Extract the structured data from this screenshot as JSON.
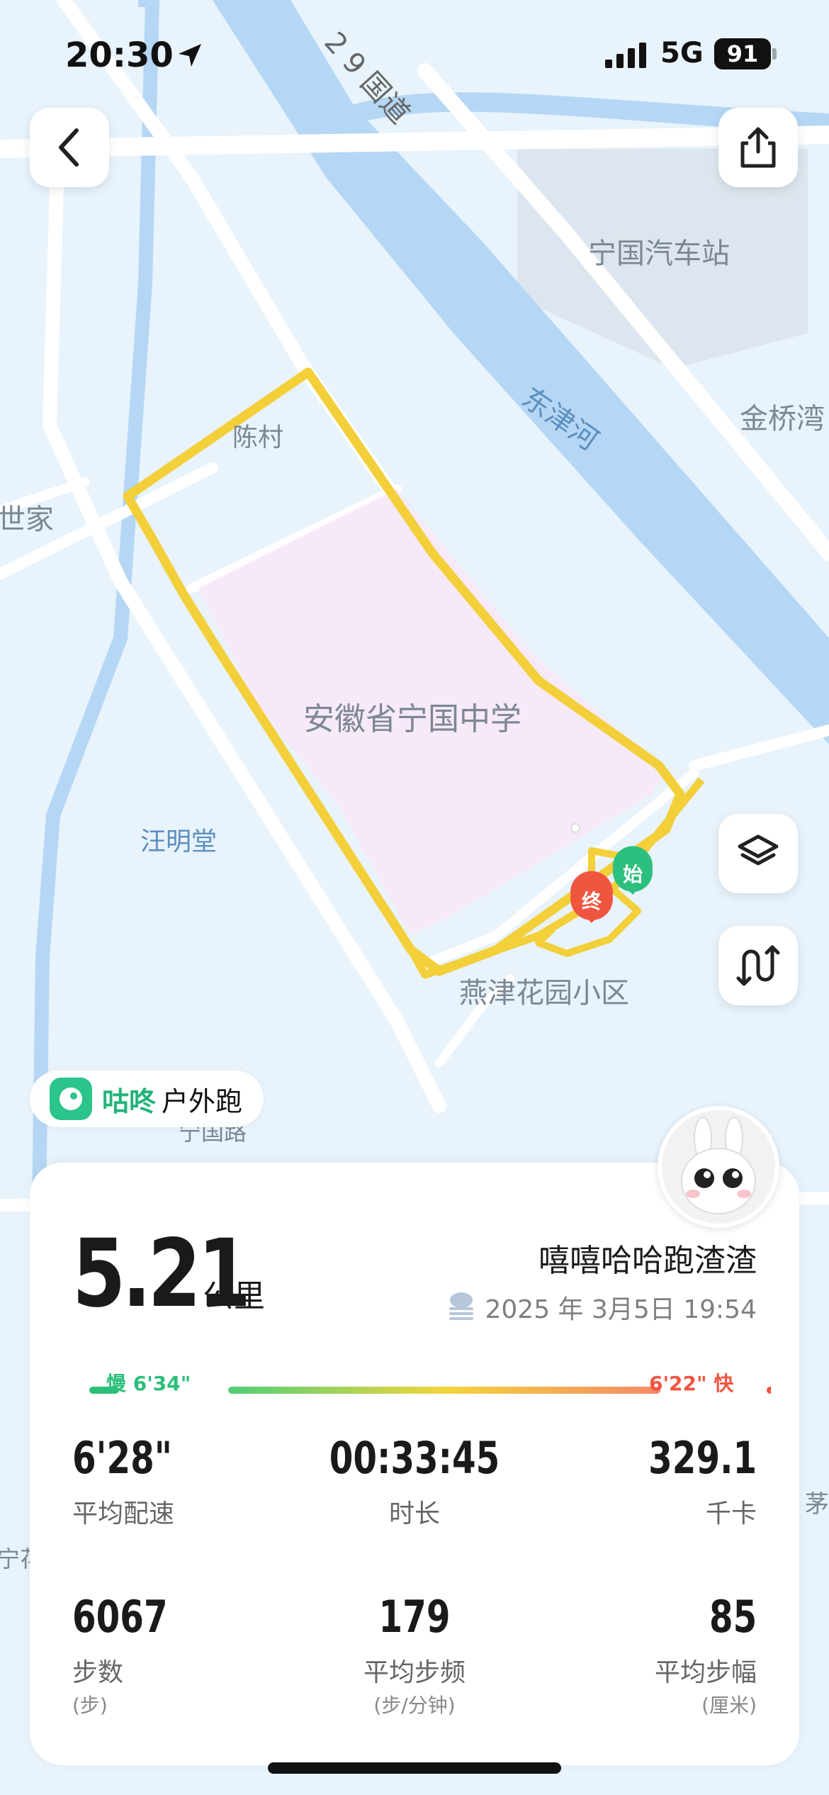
{
  "status_bar": {
    "time": "20:30",
    "network": "5G",
    "battery": "91"
  },
  "map": {
    "labels": {
      "highway": "2 9 国道",
      "bus_station": "宁国汽车站",
      "river": "东津河",
      "village": "陈村",
      "jinqiao": "金桥湾",
      "shijia": "世家",
      "school": "安徽省宁国中学",
      "wangmingtang": "汪明堂",
      "community": "燕津花园小区",
      "partial_road": "宁国路",
      "right_edge": "茅",
      "left_edge": "宁花"
    },
    "markers": {
      "start": "始",
      "end": "终"
    },
    "route_color": "#f3cf3a",
    "school_area_color": "#f6e9f8",
    "river_color": "#b5d7f5"
  },
  "source_badge": {
    "brand": "咕咚",
    "activity_type": "户外跑"
  },
  "summary": {
    "distance": "5.21",
    "distance_unit": "公里",
    "username": "嘻嘻哈哈跑渣渣",
    "datetime": "2025 年 3月5日 19:54",
    "pace_slow": "慢 6'34\"",
    "pace_fast": "6'22\" 快"
  },
  "stats": {
    "avg_pace": {
      "value": "6'28\"",
      "label": "平均配速"
    },
    "duration": {
      "value": "00:33:45",
      "label": "时长"
    },
    "calories": {
      "value": "329.1",
      "label": "千卡"
    },
    "steps": {
      "value": "6067",
      "label": "步数",
      "unit": "(步)"
    },
    "cadence": {
      "value": "179",
      "label": "平均步频",
      "unit": "(步/分钟)"
    },
    "stride": {
      "value": "85",
      "label": "平均步幅",
      "unit": "(厘米)"
    }
  },
  "icons": [
    "back-icon",
    "share-icon",
    "layers-icon",
    "route-toggle-icon",
    "location-arrow-icon",
    "weather-icon"
  ]
}
